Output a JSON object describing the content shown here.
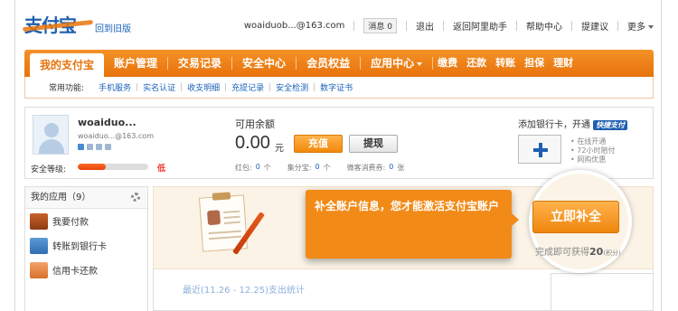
{
  "brand": {
    "logo": "支付宝",
    "old_version_link": "回到旧版"
  },
  "user_bar": {
    "account": "woaiduob...@163.com",
    "message_label": "消息",
    "message_count": "0",
    "logout": "退出",
    "aliwangwang": "返回阿里助手",
    "help": "帮助中心",
    "suggest": "提建议",
    "more": "更多"
  },
  "nav": {
    "items": [
      "我的支付宝",
      "账户管理",
      "交易记录",
      "安全中心",
      "会员权益",
      "应用中心"
    ],
    "quick": [
      "缴费",
      "还款",
      "转账",
      "担保",
      "理财"
    ]
  },
  "subnav": {
    "label": "常用功能:",
    "links": [
      "手机服务",
      "实名认证",
      "收支明细",
      "充提记录",
      "安全检测",
      "数字证书"
    ]
  },
  "account": {
    "name": "woaiduo...",
    "email": "woaiduo...@163.com",
    "security_label": "安全等级:",
    "security_level": "低",
    "security_fraction": 0.4,
    "balance_label": "可用余额",
    "balance": "0.00",
    "balance_unit": "元",
    "recharge": "充值",
    "withdraw": "提现",
    "stats": [
      {
        "label": "红包:",
        "value": "0",
        "unit": "个"
      },
      {
        "label": "集分宝:",
        "value": "0",
        "unit": "个"
      },
      {
        "label": "微客消费券:",
        "value": "0",
        "unit": "张"
      }
    ]
  },
  "bank": {
    "title": "添加银行卡，开通",
    "badge": "快捷支付",
    "features": [
      "在线开通",
      "72小时赔付",
      "网购优惠"
    ]
  },
  "apps": {
    "title": "我的应用（9）",
    "items": [
      "我要付款",
      "转账到银行卡",
      "信用卡还款"
    ]
  },
  "promo": {
    "callout": "补全账户信息，您才能激活支付宝账户",
    "activate_button": "立即补全",
    "reward_prefix": "完成即可获得",
    "reward_amount": "20",
    "reward_suffix": "(积分)",
    "footer_text": "最近(11.26 - 12.25)支出统计"
  },
  "colors": {
    "accent": "#f28a17",
    "brand": "#1f5fb0",
    "link": "#1b62b9"
  }
}
